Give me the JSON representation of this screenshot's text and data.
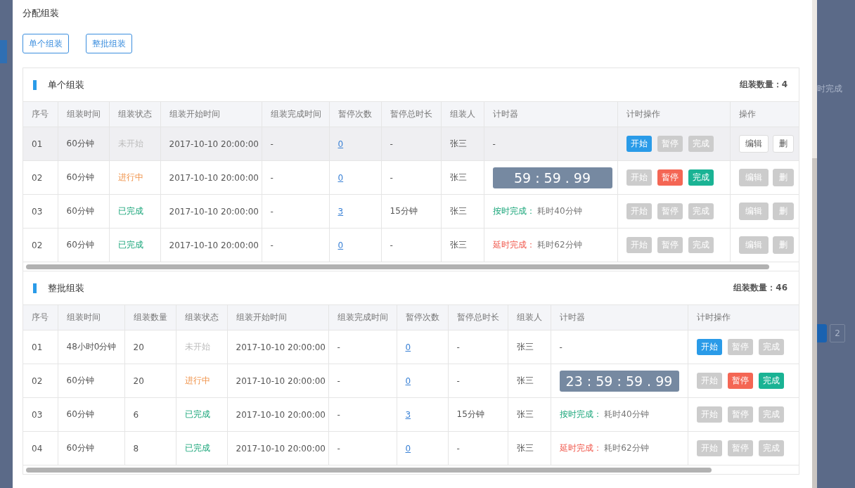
{
  "background": {
    "column_header": "时完成",
    "page_button": "2"
  },
  "dialog": {
    "title": "分配组装",
    "mode_buttons": [
      {
        "label": "单个组装"
      },
      {
        "label": "整批组装"
      }
    ],
    "sections": [
      {
        "title": "单个组装",
        "count": "组装数量：4",
        "columns": [
          "序号",
          "组装时间",
          "组装状态",
          "组装开始时间",
          "组装完成时间",
          "暂停次数",
          "暂停总时长",
          "组装人",
          "计时器",
          "计时操作",
          "操作"
        ],
        "rows": [
          {
            "highlighted": true,
            "cells": [
              {
                "kind": "text",
                "text": "01"
              },
              {
                "kind": "text",
                "text": "60分钟"
              },
              {
                "kind": "pending",
                "text": "未开始"
              },
              {
                "kind": "text",
                "text": "2017-10-10 20:00:00"
              },
              {
                "kind": "text",
                "text": "-"
              },
              {
                "kind": "link",
                "text": "0"
              },
              {
                "kind": "text",
                "text": "-"
              },
              {
                "kind": "text",
                "text": "张三"
              },
              {
                "kind": "text",
                "text": "-"
              },
              {
                "kind": "actions",
                "buttons": [
                  {
                    "kind": "start",
                    "label": "开始",
                    "disabled": false
                  },
                  {
                    "kind": "pause",
                    "label": "暂停",
                    "disabled": true
                  },
                  {
                    "kind": "finish",
                    "label": "完成",
                    "disabled": true
                  }
                ]
              },
              {
                "kind": "actions",
                "buttons": [
                  {
                    "kind": "edit",
                    "label": "编辑",
                    "disabled": false
                  },
                  {
                    "kind": "edit",
                    "label": "删",
                    "disabled": false
                  }
                ]
              }
            ]
          },
          {
            "highlighted": false,
            "cells": [
              {
                "kind": "text",
                "text": "02"
              },
              {
                "kind": "text",
                "text": "60分钟"
              },
              {
                "kind": "running",
                "text": "进行中"
              },
              {
                "kind": "text",
                "text": "2017-10-10 20:00:00"
              },
              {
                "kind": "text",
                "text": "-"
              },
              {
                "kind": "link",
                "text": "0"
              },
              {
                "kind": "text",
                "text": "-"
              },
              {
                "kind": "text",
                "text": "张三"
              },
              {
                "kind": "clock",
                "text": "59 : 59 . 99"
              },
              {
                "kind": "actions",
                "buttons": [
                  {
                    "kind": "start",
                    "label": "开始",
                    "disabled": true
                  },
                  {
                    "kind": "pause",
                    "label": "暂停",
                    "disabled": false
                  },
                  {
                    "kind": "finish",
                    "label": "完成",
                    "disabled": false
                  }
                ]
              },
              {
                "kind": "actions",
                "buttons": [
                  {
                    "kind": "edit",
                    "label": "编辑",
                    "disabled": true
                  },
                  {
                    "kind": "edit",
                    "label": "删",
                    "disabled": true
                  }
                ]
              }
            ]
          },
          {
            "highlighted": false,
            "cells": [
              {
                "kind": "text",
                "text": "03"
              },
              {
                "kind": "text",
                "text": "60分钟"
              },
              {
                "kind": "done",
                "text": "已完成"
              },
              {
                "kind": "text",
                "text": "2017-10-10 20:00:00"
              },
              {
                "kind": "text",
                "text": "-"
              },
              {
                "kind": "link",
                "text": "3"
              },
              {
                "kind": "text",
                "text": "15分钟"
              },
              {
                "kind": "text",
                "text": "张三"
              },
              {
                "kind": "ontime",
                "label": "按时完成：",
                "text": "耗时40分钟"
              },
              {
                "kind": "actions",
                "buttons": [
                  {
                    "kind": "start",
                    "label": "开始",
                    "disabled": true
                  },
                  {
                    "kind": "pause",
                    "label": "暂停",
                    "disabled": true
                  },
                  {
                    "kind": "finish",
                    "label": "完成",
                    "disabled": true
                  }
                ]
              },
              {
                "kind": "actions",
                "buttons": [
                  {
                    "kind": "edit",
                    "label": "编辑",
                    "disabled": true
                  },
                  {
                    "kind": "edit",
                    "label": "删",
                    "disabled": true
                  }
                ]
              }
            ]
          },
          {
            "highlighted": false,
            "cells": [
              {
                "kind": "text",
                "text": "02"
              },
              {
                "kind": "text",
                "text": "60分钟"
              },
              {
                "kind": "done",
                "text": "已完成"
              },
              {
                "kind": "text",
                "text": "2017-10-10 20:00:00"
              },
              {
                "kind": "text",
                "text": "-"
              },
              {
                "kind": "link",
                "text": "0"
              },
              {
                "kind": "text",
                "text": "-"
              },
              {
                "kind": "text",
                "text": "张三"
              },
              {
                "kind": "late",
                "label": "延时完成：",
                "text": "耗时62分钟"
              },
              {
                "kind": "actions",
                "buttons": [
                  {
                    "kind": "start",
                    "label": "开始",
                    "disabled": true
                  },
                  {
                    "kind": "pause",
                    "label": "暂停",
                    "disabled": true
                  },
                  {
                    "kind": "finish",
                    "label": "完成",
                    "disabled": true
                  }
                ]
              },
              {
                "kind": "actions",
                "buttons": [
                  {
                    "kind": "edit",
                    "label": "编辑",
                    "disabled": true
                  },
                  {
                    "kind": "edit",
                    "label": "删",
                    "disabled": true
                  }
                ]
              }
            ]
          }
        ]
      },
      {
        "title": "整批组装",
        "count": "组装数量：46",
        "columns": [
          "序号",
          "组装时间",
          "组装数量",
          "组装状态",
          "组装开始时间",
          "组装完成时间",
          "暂停次数",
          "暂停总时长",
          "组装人",
          "计时器",
          "计时操作"
        ],
        "rows": [
          {
            "highlighted": false,
            "cells": [
              {
                "kind": "text",
                "text": "01"
              },
              {
                "kind": "text",
                "text": "48小时0分钟"
              },
              {
                "kind": "text",
                "text": "20"
              },
              {
                "kind": "pending",
                "text": "未开始"
              },
              {
                "kind": "text",
                "text": "2017-10-10 20:00:00"
              },
              {
                "kind": "text",
                "text": "-"
              },
              {
                "kind": "link",
                "text": "0"
              },
              {
                "kind": "text",
                "text": "-"
              },
              {
                "kind": "text",
                "text": "张三"
              },
              {
                "kind": "text",
                "text": "-"
              },
              {
                "kind": "actions",
                "buttons": [
                  {
                    "kind": "start",
                    "label": "开始",
                    "disabled": false
                  },
                  {
                    "kind": "pause",
                    "label": "暂停",
                    "disabled": true
                  },
                  {
                    "kind": "finish",
                    "label": "完成",
                    "disabled": true
                  }
                ]
              }
            ]
          },
          {
            "highlighted": false,
            "cells": [
              {
                "kind": "text",
                "text": "02"
              },
              {
                "kind": "text",
                "text": "60分钟"
              },
              {
                "kind": "text",
                "text": "20"
              },
              {
                "kind": "running",
                "text": "进行中"
              },
              {
                "kind": "text",
                "text": "2017-10-10 20:00:00"
              },
              {
                "kind": "text",
                "text": "-"
              },
              {
                "kind": "link",
                "text": "0"
              },
              {
                "kind": "text",
                "text": "-"
              },
              {
                "kind": "text",
                "text": "张三"
              },
              {
                "kind": "clock",
                "text": "23 : 59 : 59 . 99"
              },
              {
                "kind": "actions",
                "buttons": [
                  {
                    "kind": "start",
                    "label": "开始",
                    "disabled": true
                  },
                  {
                    "kind": "pause",
                    "label": "暂停",
                    "disabled": false
                  },
                  {
                    "kind": "finish",
                    "label": "完成",
                    "disabled": false
                  }
                ]
              }
            ]
          },
          {
            "highlighted": false,
            "cells": [
              {
                "kind": "text",
                "text": "03"
              },
              {
                "kind": "text",
                "text": "60分钟"
              },
              {
                "kind": "text",
                "text": "6"
              },
              {
                "kind": "done",
                "text": "已完成"
              },
              {
                "kind": "text",
                "text": "2017-10-10 20:00:00"
              },
              {
                "kind": "text",
                "text": "-"
              },
              {
                "kind": "link",
                "text": "3"
              },
              {
                "kind": "text",
                "text": "15分钟"
              },
              {
                "kind": "text",
                "text": "张三"
              },
              {
                "kind": "ontime",
                "label": "按时完成：",
                "text": "耗时40分钟"
              },
              {
                "kind": "actions",
                "buttons": [
                  {
                    "kind": "start",
                    "label": "开始",
                    "disabled": true
                  },
                  {
                    "kind": "pause",
                    "label": "暂停",
                    "disabled": true
                  },
                  {
                    "kind": "finish",
                    "label": "完成",
                    "disabled": true
                  }
                ]
              }
            ]
          },
          {
            "highlighted": false,
            "cells": [
              {
                "kind": "text",
                "text": "04"
              },
              {
                "kind": "text",
                "text": "60分钟"
              },
              {
                "kind": "text",
                "text": "8"
              },
              {
                "kind": "done",
                "text": "已完成"
              },
              {
                "kind": "text",
                "text": "2017-10-10 20:00:00"
              },
              {
                "kind": "text",
                "text": "-"
              },
              {
                "kind": "link",
                "text": "0"
              },
              {
                "kind": "text",
                "text": "-"
              },
              {
                "kind": "text",
                "text": "张三"
              },
              {
                "kind": "late",
                "label": "延时完成：",
                "text": "耗时62分钟"
              },
              {
                "kind": "actions",
                "buttons": [
                  {
                    "kind": "start",
                    "label": "开始",
                    "disabled": true
                  },
                  {
                    "kind": "pause",
                    "label": "暂停",
                    "disabled": true
                  },
                  {
                    "kind": "finish",
                    "label": "完成",
                    "disabled": true
                  }
                ]
              }
            ]
          }
        ]
      }
    ]
  }
}
